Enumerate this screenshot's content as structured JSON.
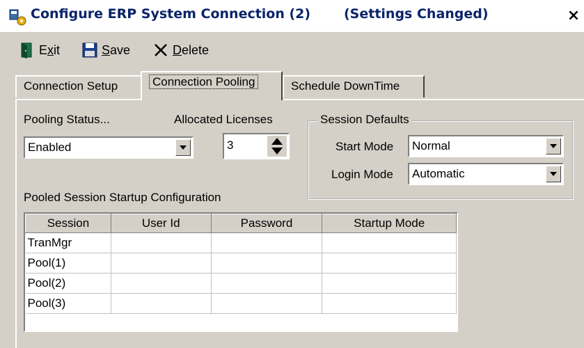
{
  "window": {
    "title": "Configure ERP System Connection (2)",
    "status": "(Settings Changed)",
    "close_glyph": "×"
  },
  "toolbar": {
    "exit_label": "Exit",
    "save_label": "Save",
    "delete_label": "Delete",
    "exit_icon": "exit-door-icon",
    "save_icon": "floppy-disk-icon",
    "delete_icon": "delete-x-icon"
  },
  "tabs": [
    {
      "label": "Connection Setup",
      "active": false
    },
    {
      "label": "Connection Pooling",
      "active": true
    },
    {
      "label": "Schedule DownTime",
      "active": false
    }
  ],
  "pooling": {
    "status_label": "Pooling Status...",
    "status_value": "Enabled",
    "licenses_label": "Allocated Licenses",
    "licenses_value": "3"
  },
  "session_defaults": {
    "title": "Session Defaults",
    "start_mode_label": "Start Mode",
    "start_mode_value": "Normal",
    "login_mode_label": "Login Mode",
    "login_mode_value": "Automatic"
  },
  "pooled_config": {
    "title": "Pooled Session Startup Configuration",
    "columns": [
      "Session",
      "User Id",
      "Password",
      "Startup Mode"
    ],
    "rows": [
      [
        "TranMgr",
        "",
        "",
        ""
      ],
      [
        "Pool(1)",
        "",
        "",
        ""
      ],
      [
        "Pool(2)",
        "",
        "",
        ""
      ],
      [
        "Pool(3)",
        "",
        "",
        ""
      ]
    ]
  },
  "colors": {
    "window_bg": "#d4d0c8",
    "title_text": "#0a246a"
  }
}
